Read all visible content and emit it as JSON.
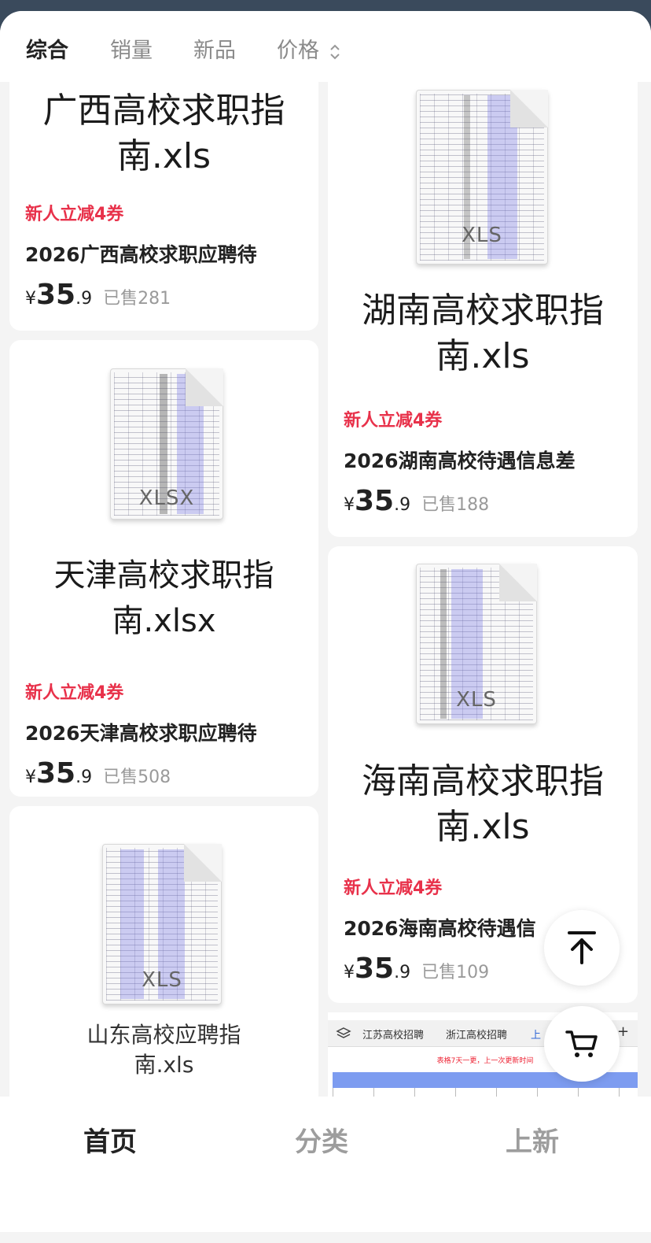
{
  "sort_bar": {
    "items": [
      "综合",
      "销量",
      "新品",
      "价格"
    ]
  },
  "products": [
    {
      "image_title": "广西高校求职指南.xls",
      "image_title_l1": "广西高校求职指",
      "image_title_l2": "南.xls",
      "coupon": "新人立减4券",
      "name": "2026广西高校求职应聘待",
      "price_currency": "¥",
      "price_int": "35",
      "price_dec": ".9",
      "sold": "已售281"
    },
    {
      "image_title_l1": "湖南高校求职指",
      "image_title_l2": "南.xls",
      "file_ext": "XLS",
      "coupon": "新人立减4券",
      "name": "2026湖南高校待遇信息差",
      "price_currency": "¥",
      "price_int": "35",
      "price_dec": ".9",
      "sold": "已售188"
    },
    {
      "image_title_l1": "天津高校求职指",
      "image_title_l2": "南.xlsx",
      "file_ext": "XLSX",
      "coupon": "新人立减4券",
      "name": "2026天津高校求职应聘待",
      "price_currency": "¥",
      "price_int": "35",
      "price_dec": ".9",
      "sold": "已售508"
    },
    {
      "image_title_l1": "海南高校求职指",
      "image_title_l2": "南.xls",
      "file_ext": "XLS",
      "coupon": "新人立减4券",
      "name": "2026海南高校待遇信",
      "price_currency": "¥",
      "price_int": "35",
      "price_dec": ".9",
      "sold": "已售109"
    },
    {
      "image_title_l1": "山东高校应聘指",
      "image_title_l2": "南.xls",
      "file_ext": "XLS"
    }
  ],
  "sheet_preview": {
    "tabs": [
      "江苏高校招聘",
      "浙江高校招聘",
      "上"
    ],
    "add": "+",
    "banner": "表格7天一更，上一次更新时间"
  },
  "floating": {
    "top_icon": "arrow-up-to-top-icon",
    "cart_icon": "cart-icon"
  },
  "bottom_nav": [
    "首页",
    "分类",
    "上新"
  ],
  "colors": {
    "accent_red": "#e8314a",
    "header_bg": "#3a4a5c"
  }
}
